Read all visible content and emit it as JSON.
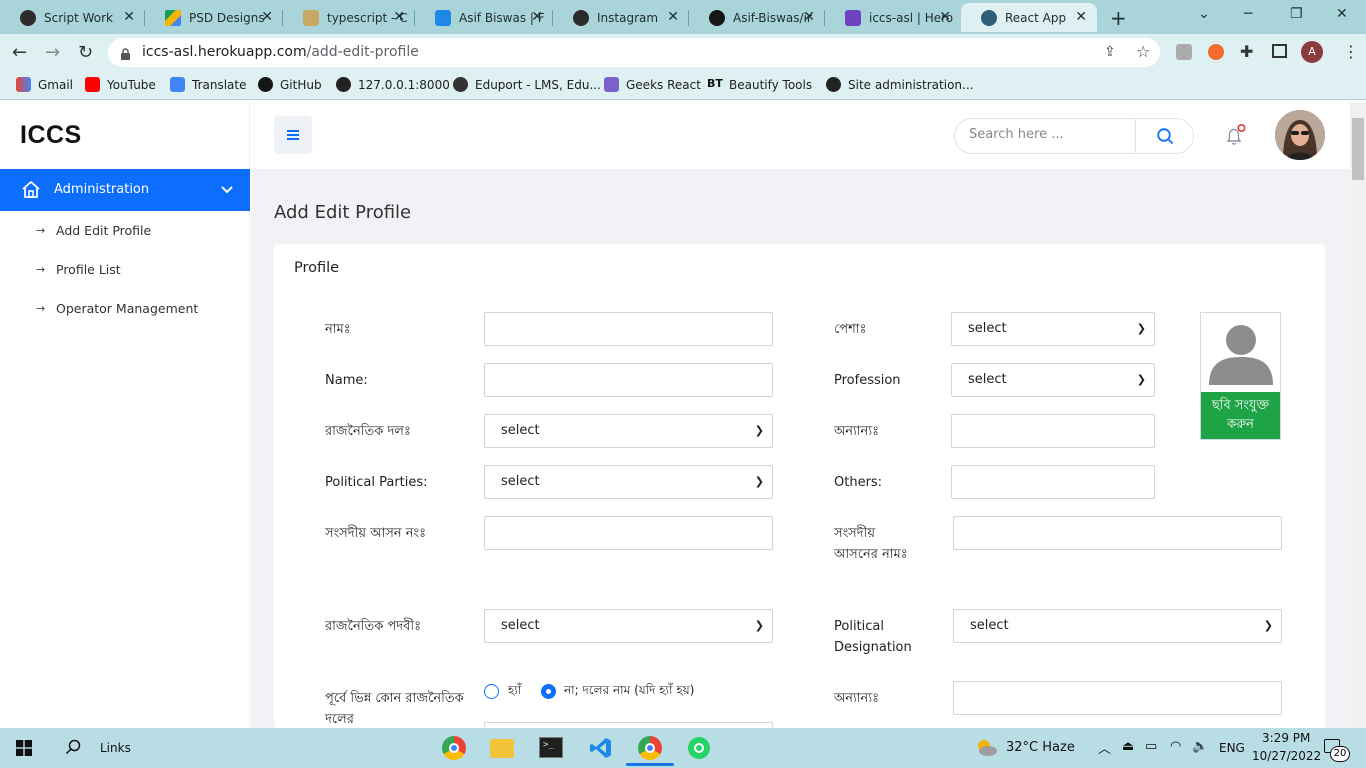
{
  "browser": {
    "tabs": [
      {
        "label": "Script Work",
        "color": "#222"
      },
      {
        "label": "PSD Designs",
        "color": "#f4b400"
      },
      {
        "label": "typescript - C",
        "color": "#b58b44"
      },
      {
        "label": "Asif Biswas | F",
        "color": "#0a66c2"
      },
      {
        "label": "Instagram",
        "color": "#222"
      },
      {
        "label": "Asif-Biswas/ir",
        "color": "#111"
      },
      {
        "label": "iccs-asl | Hero",
        "color": "#6f42c1"
      },
      {
        "label": "React App",
        "color": "#2f5e7a"
      }
    ],
    "active_tab": "React App",
    "url_host": "iccs-asl.herokuapp.com",
    "url_path": "/add-edit-profile",
    "profile_initial": "A",
    "bookmarks": [
      "Gmail",
      "YouTube",
      "Translate",
      "GitHub",
      "127.0.0.1:8000",
      "Eduport - LMS, Edu...",
      "Geeks React",
      "Beautify Tools",
      "Site administration..."
    ]
  },
  "sidebar": {
    "logo": "ICCS",
    "section": "Administration",
    "items": [
      "Add Edit Profile",
      "Profile List",
      "Operator Management"
    ]
  },
  "header": {
    "search_placeholder": "Search here ..."
  },
  "page": {
    "title": "Add Edit Profile",
    "card_title": "Profile"
  },
  "form": {
    "name_bn_label": "নামঃ",
    "name_en_label": "Name:",
    "party_bn_label": "রাজনৈতিক দলঃ",
    "party_en_label": "Political Parties:",
    "seat_no_label": "সংসদীয় আসন নংঃ",
    "designation_bn_label": "রাজনৈতিক পদবীঃ",
    "prev_party_label": "পূর্বে ভিন্ন কোন রাজনৈতিক দলের",
    "profession_bn_label": "পেশাঃ",
    "profession_en_label": "Profession",
    "others_bn_label": "অন্যান্যঃ",
    "others_en_label": "Others:",
    "seat_name_label": "সংসদীয় আসনের নামঃ",
    "designation_en_label": "Political Designation",
    "others_bn_label_2": "অন্যান্যঃ",
    "select_text": "select",
    "radio_yes": "হ্যাঁ",
    "radio_no": "না; দলের নাম (যদি হ্যাঁ হয়)",
    "photo_button": "ছবি সংযুক্ত করুন"
  },
  "taskbar": {
    "search_label": "Links",
    "weather": "32°C  Haze",
    "lang": "ENG",
    "time": "3:29 PM",
    "date": "10/27/2022",
    "notifications": "20"
  }
}
